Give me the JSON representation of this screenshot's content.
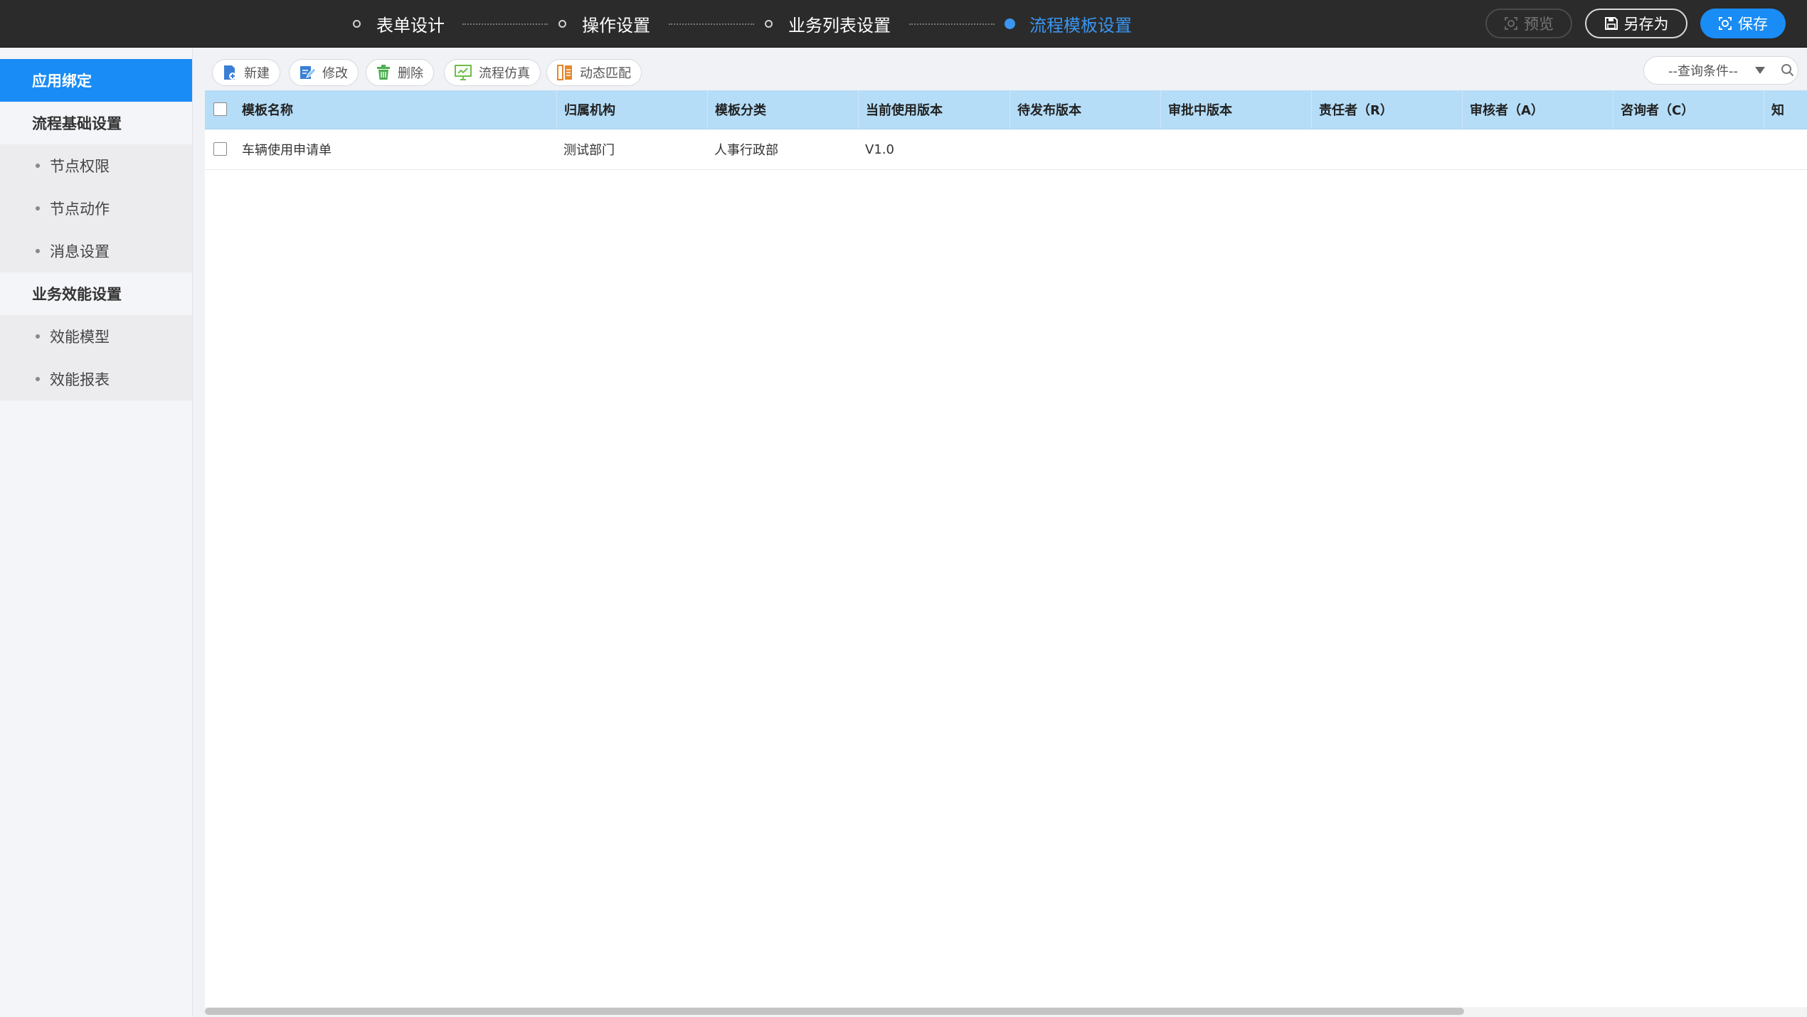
{
  "steps": [
    {
      "label": "表单设计",
      "active": false
    },
    {
      "label": "操作设置",
      "active": false
    },
    {
      "label": "业务列表设置",
      "active": false
    },
    {
      "label": "流程模板设置",
      "active": true
    }
  ],
  "actions": {
    "preview": "预览",
    "save_as": "另存为",
    "save": "保存"
  },
  "sidebar": {
    "active": "应用绑定",
    "groups": [
      {
        "title": "流程基础设置",
        "items": [
          "节点权限",
          "节点动作",
          "消息设置"
        ]
      },
      {
        "title": "业务效能设置",
        "items": [
          "效能模型",
          "效能报表"
        ]
      }
    ]
  },
  "toolbar": {
    "new": "新建",
    "edit": "修改",
    "delete": "删除",
    "simulate": "流程仿真",
    "dynamic_match": "动态匹配",
    "query_placeholder": "--查询条件--"
  },
  "table": {
    "headers": [
      "模板名称",
      "归属机构",
      "模板分类",
      "当前使用版本",
      "待发布版本",
      "审批中版本",
      "责任者（R）",
      "审核者（A）",
      "咨询者（C）",
      "知"
    ],
    "rows": [
      [
        "车辆使用申请单",
        "测试部门",
        "人事行政部",
        "V1.0",
        "",
        "",
        "",
        "",
        "",
        ""
      ]
    ]
  },
  "colors": {
    "accent": "#1a8cf5",
    "topbar": "#2b2b2b",
    "table_header": "#b5ddf7"
  }
}
